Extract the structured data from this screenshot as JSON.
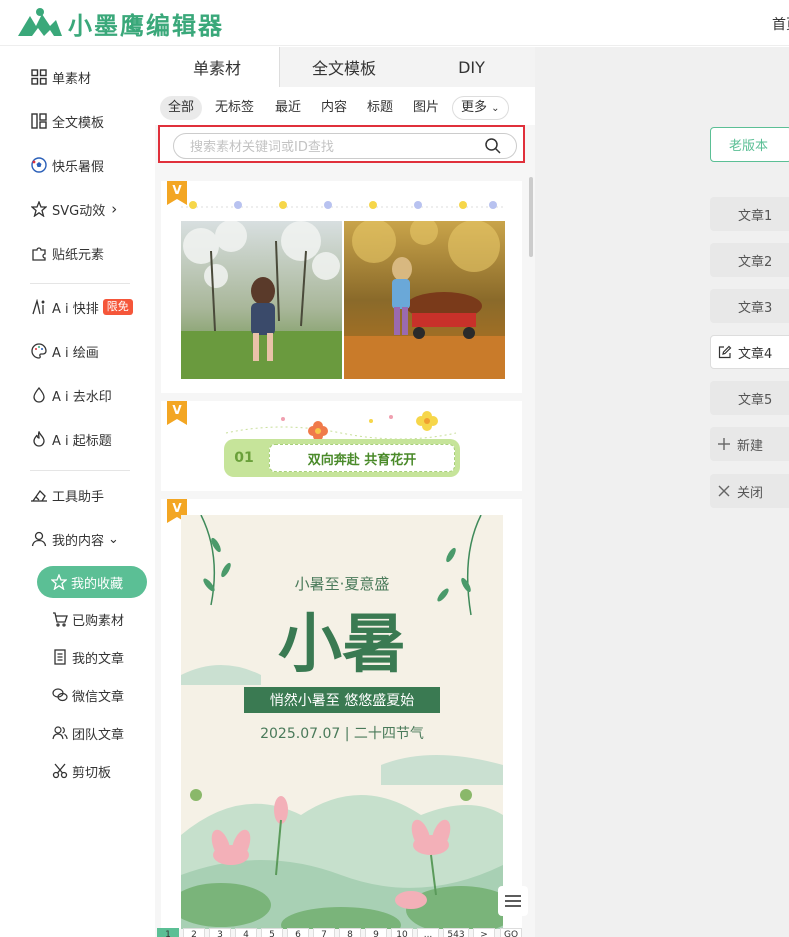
{
  "header": {
    "logo_text": "小墨鹰编辑器",
    "nav_home": "首页"
  },
  "sidebar": {
    "items": [
      {
        "label": "单素材",
        "icon": "grid-icon"
      },
      {
        "label": "全文模板",
        "icon": "template-icon"
      },
      {
        "label": "快乐暑假",
        "icon": "soccer-ball-icon"
      },
      {
        "label": "SVG动效",
        "icon": "star-icon",
        "arrow": "›"
      },
      {
        "label": "贴纸元素",
        "icon": "puzzle-icon"
      },
      {
        "label": "A i 快排",
        "icon": "ai-icon",
        "badge": "限免"
      },
      {
        "label": "A i 绘画",
        "icon": "palette-icon"
      },
      {
        "label": "A i 去水印",
        "icon": "drop-icon"
      },
      {
        "label": "A i 起标题",
        "icon": "flame-icon"
      },
      {
        "label": "工具助手",
        "icon": "tools-icon"
      },
      {
        "label": "我的内容",
        "icon": "user-icon",
        "arrow": "⌄"
      }
    ],
    "sub_items": [
      {
        "label": "我的收藏",
        "icon": "star-outline-icon"
      },
      {
        "label": "已购素材",
        "icon": "cart-icon"
      },
      {
        "label": "我的文章",
        "icon": "document-icon"
      },
      {
        "label": "微信文章",
        "icon": "wechat-icon"
      },
      {
        "label": "团队文章",
        "icon": "team-icon"
      },
      {
        "label": "剪切板",
        "icon": "scissors-icon"
      }
    ]
  },
  "panel": {
    "tabs": [
      "单素材",
      "全文模板",
      "DIY"
    ],
    "filters": [
      "全部",
      "无标签",
      "最近",
      "内容",
      "标题",
      "图片",
      "更多"
    ],
    "search_placeholder": "搜索素材关键词或ID查找",
    "ribbon_label": "V",
    "card2": {
      "number": "01",
      "title": "双向奔赴 共育花开"
    },
    "card3": {
      "subtitle": "小暑至·夏意盛",
      "title": "小暑",
      "banner": "悄然小暑至 悠悠盛夏始",
      "date": "2025.07.07 | 二十四节气"
    },
    "pages": [
      "1",
      "2",
      "3",
      "4",
      "5",
      "6",
      "7",
      "8",
      "9",
      "10",
      "...",
      "543",
      ">",
      "GO"
    ]
  },
  "right": {
    "old_version": "老版本",
    "article_tabs": [
      "文章1",
      "文章2",
      "文章3",
      "文章4",
      "文章5"
    ],
    "new_label": "新建",
    "close_label": "关闭"
  },
  "colors": {
    "brand": "#3aa87a",
    "accent": "#5bbf95",
    "highlight": "#e0303b",
    "badge": "#f5563a",
    "ribbon": "#f3a623"
  }
}
